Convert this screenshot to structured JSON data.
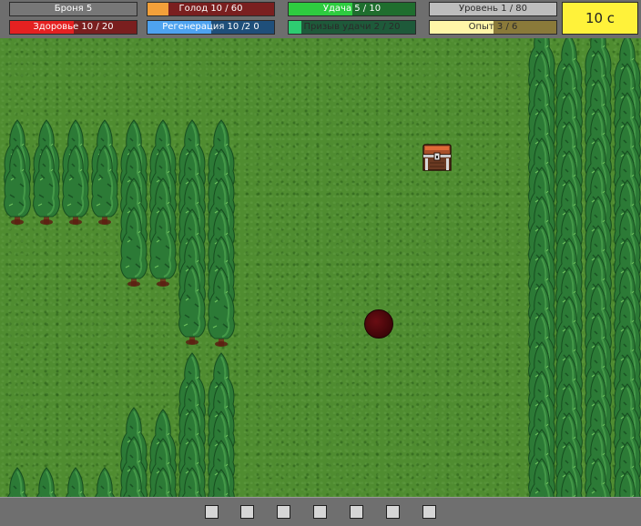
{
  "hud": {
    "stats": [
      {
        "label": "Броня 5",
        "fill": 0.0,
        "track": "#777777",
        "fill_color": "#9a9a9a",
        "text": "light"
      },
      {
        "label": "Здоровье 10 / 20",
        "fill": 0.5,
        "track": "#7a1f1f",
        "fill_color": "#e52121",
        "text": "light"
      },
      {
        "label": "Голод 10 / 60",
        "fill": 0.167,
        "track": "#7a1f1f",
        "fill_color": "#f2a03a",
        "text": "light"
      },
      {
        "label": "Регенерация 10 /2 0",
        "fill": 0.5,
        "track": "#1f4f7a",
        "fill_color": "#4ea3f0",
        "text": "light"
      },
      {
        "label": "Удача 5 / 10",
        "fill": 0.5,
        "track": "#1f6e2e",
        "fill_color": "#2ecc40",
        "text": "light"
      },
      {
        "label": "Призыв удачи 2 / 20",
        "fill": 0.1,
        "track": "#1e5a3a",
        "fill_color": "#2ecc71",
        "text": "dark"
      },
      {
        "label": "Уровень 1 / 80",
        "fill": 0.0,
        "track": "#bdbdbd",
        "fill_color": "#d9d9d9",
        "text": "dark"
      },
      {
        "label": "Опыт 3 / 6",
        "fill": 0.5,
        "track": "#8a7a3a",
        "fill_color": "#fff6a8",
        "text": "dark"
      }
    ],
    "timer": "10 с",
    "timer_color": "#fff23a"
  },
  "world": {
    "grass_color": "#4f8c30",
    "tree_color": "#2f7a3a",
    "player_color": "#5a0a10",
    "chest": "treasure-chest-icon"
  },
  "hotbar": {
    "slot_count": 7
  }
}
